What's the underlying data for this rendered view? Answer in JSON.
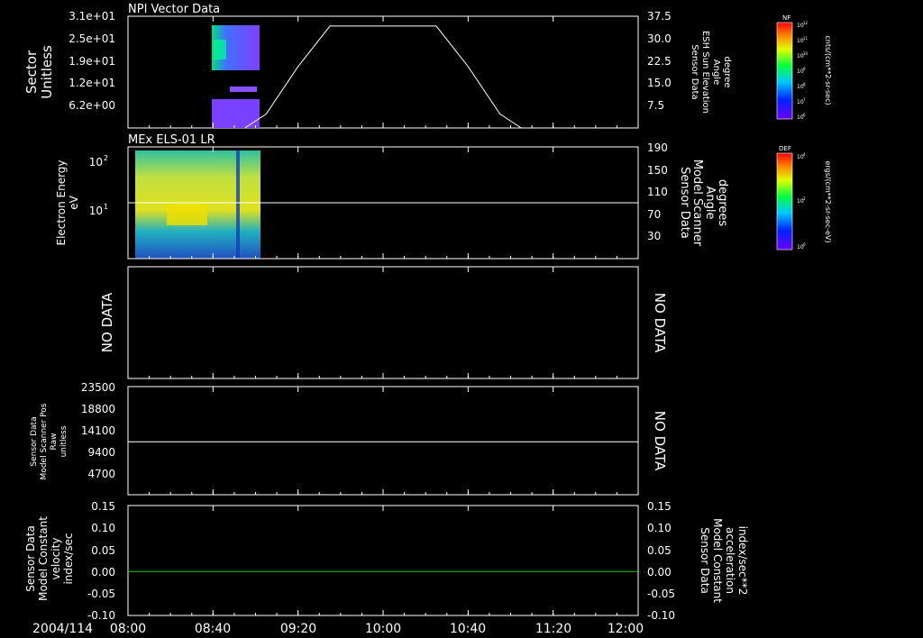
{
  "x_axis": {
    "date_label": "2004/114",
    "ticks": [
      "08:00",
      "08:40",
      "09:20",
      "10:00",
      "10:40",
      "11:20",
      "12:00"
    ]
  },
  "panels": [
    {
      "title": "NPI Vector Data",
      "left_label": [
        "Sector",
        "Unitless"
      ],
      "left_ticks": [
        "3.1e+01",
        "2.5e+01",
        "1.9e+01",
        "1.2e+01",
        "6.2e+00"
      ],
      "right_label": [
        "Sensor Data",
        "ESH Sun Elevation",
        "Angle",
        "degree"
      ],
      "right_ticks": [
        "37.5",
        "30.0",
        "22.5",
        "15.0",
        "7.5"
      ]
    },
    {
      "title": "MEx ELS-01 LR",
      "left_label": [
        "Electron Energy",
        "eV"
      ],
      "left_ticks": [
        "10",
        "10"
      ],
      "left_tick_exp": [
        "2",
        "1"
      ],
      "right_label": [
        "Sensor Data",
        "Model Scanner",
        "Angle",
        "degrees"
      ],
      "right_ticks": [
        "190",
        "150",
        "110",
        "70",
        "30"
      ]
    },
    {
      "title": "",
      "left_label": [
        "NO DATA"
      ],
      "left_ticks": [],
      "right_label": [
        "NO DATA"
      ],
      "right_ticks": []
    },
    {
      "title": "",
      "left_label": [
        "Sensor Data",
        "Model Scanner Pos",
        "Raw",
        "unitless"
      ],
      "left_ticks": [
        "23500",
        "18800",
        "14100",
        "9400",
        "4700"
      ],
      "right_label": [
        "NO DATA"
      ],
      "right_ticks": []
    },
    {
      "title": "",
      "left_label": [
        "Sensor Data",
        "Model Constant",
        "velocity",
        "index/sec"
      ],
      "left_ticks": [
        "0.15",
        "0.10",
        "0.05",
        "0.00",
        "-0.05",
        "-0.10"
      ],
      "right_label": [
        "Sensor Data",
        "Model Constant",
        "acceleration",
        "index/sec**2"
      ],
      "right_ticks": [
        "0.15",
        "0.10",
        "0.05",
        "0.00",
        "-0.05",
        "-0.10"
      ],
      "right_label_color": "#00ff00"
    }
  ],
  "colorbars": [
    {
      "name": "NF",
      "label": "cnts/(cm**2-sr-sec)",
      "ticks": [
        "10",
        "10",
        "10",
        "10",
        "10",
        "10",
        "10"
      ],
      "tick_exp": [
        "12",
        "11",
        "10",
        "9",
        "8",
        "7",
        "6"
      ]
    },
    {
      "name": "DEF",
      "label": "ergs/(cm**2-sr-sec-eV)",
      "ticks": [
        "10",
        "10",
        "10"
      ],
      "tick_exp": [
        "4",
        "2",
        "0"
      ]
    }
  ],
  "chart_data": [
    {
      "type": "line",
      "series": [
        {
          "x": [
            "08:55",
            "09:05",
            "09:20",
            "09:35",
            "10:25",
            "10:40",
            "10:55",
            "11:05"
          ],
          "y": [
            0,
            5,
            22,
            36.5,
            36.5,
            22,
            5,
            0
          ]
        }
      ],
      "xlim": [
        "08:00",
        "12:00"
      ],
      "ylim": [
        0,
        40
      ]
    },
    {
      "type": "line",
      "series": [
        {
          "x": [
            "08:00",
            "12:00"
          ],
          "y": [
            95,
            95
          ]
        }
      ],
      "xlim": [
        "08:00",
        "12:00"
      ],
      "ylim": [
        0,
        190
      ]
    },
    {
      "type": "line",
      "series": [
        {
          "x": [
            "08:00",
            "12:00"
          ],
          "y": [
            11500,
            11500
          ]
        }
      ],
      "xlim": [
        "08:00",
        "12:00"
      ],
      "ylim": [
        0,
        23500
      ]
    },
    {
      "type": "line",
      "series": [
        {
          "x": [
            "08:00",
            "12:00"
          ],
          "y": [
            0,
            0
          ],
          "color": "#00cc00"
        }
      ],
      "xlim": [
        "08:00",
        "12:00"
      ],
      "ylim": [
        -0.1,
        0.15
      ]
    }
  ]
}
